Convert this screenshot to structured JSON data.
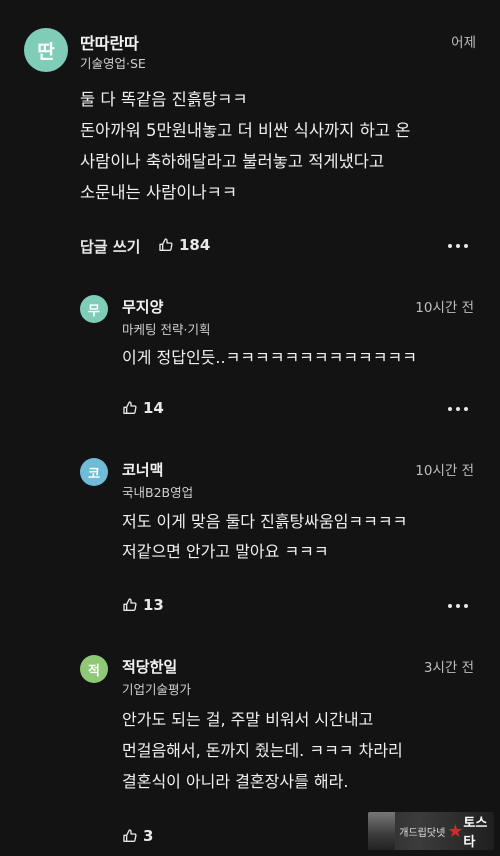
{
  "comments": [
    {
      "avatar": "딴",
      "avatar_color": "#7fcdb8",
      "name": "딴따란따",
      "role": "기술영업·SE",
      "time": "어제",
      "lines": [
        "둘 다 똑같음 진흙탕ㅋㅋ",
        "돈아까워 5만원내놓고 더 비싼 식사까지 하고 온",
        "사람이나 축하해달라고 불러놓고 적게냈다고",
        "소문내는 사람이나ㅋㅋ"
      ],
      "reply_label": "답글 쓰기",
      "likes": "184"
    },
    {
      "avatar": "무",
      "avatar_color": "#7fcdb8",
      "name": "무지양",
      "role": "마케팅 전략·기획",
      "time": "10시간 전",
      "lines": [
        "이게 정답인듯..ㅋㅋㅋㅋㅋㅋㅋㅋㅋㅋㅋㅋㅋ"
      ],
      "likes": "14"
    },
    {
      "avatar": "코",
      "avatar_color": "#6fbbd8",
      "name": "코너맥",
      "role": "국내B2B영업",
      "time": "10시간 전",
      "lines": [
        "저도 이게 맞음 둘다 진흙탕싸움임ㅋㅋㅋㅋ",
        "저같으면 안가고 말아요 ㅋㅋㅋ"
      ],
      "likes": "13"
    },
    {
      "avatar": "적",
      "avatar_color": "#8fc978",
      "name": "적당한일",
      "role": "기업기술평가",
      "time": "3시간 전",
      "lines": [
        "안가도 되는 걸, 주말 비워서 시간내고",
        "먼걸음해서, 돈까지 줬는데. ㅋㅋㅋ 차라리",
        "결혼식이 아니라 결혼장사를 해라."
      ],
      "likes": "3"
    }
  ],
  "icons": {
    "like": "thumbs-up-icon",
    "more": "more-horizontal-icon"
  },
  "watermark": {
    "text": "개드립닷넷",
    "brand": "토스타"
  }
}
